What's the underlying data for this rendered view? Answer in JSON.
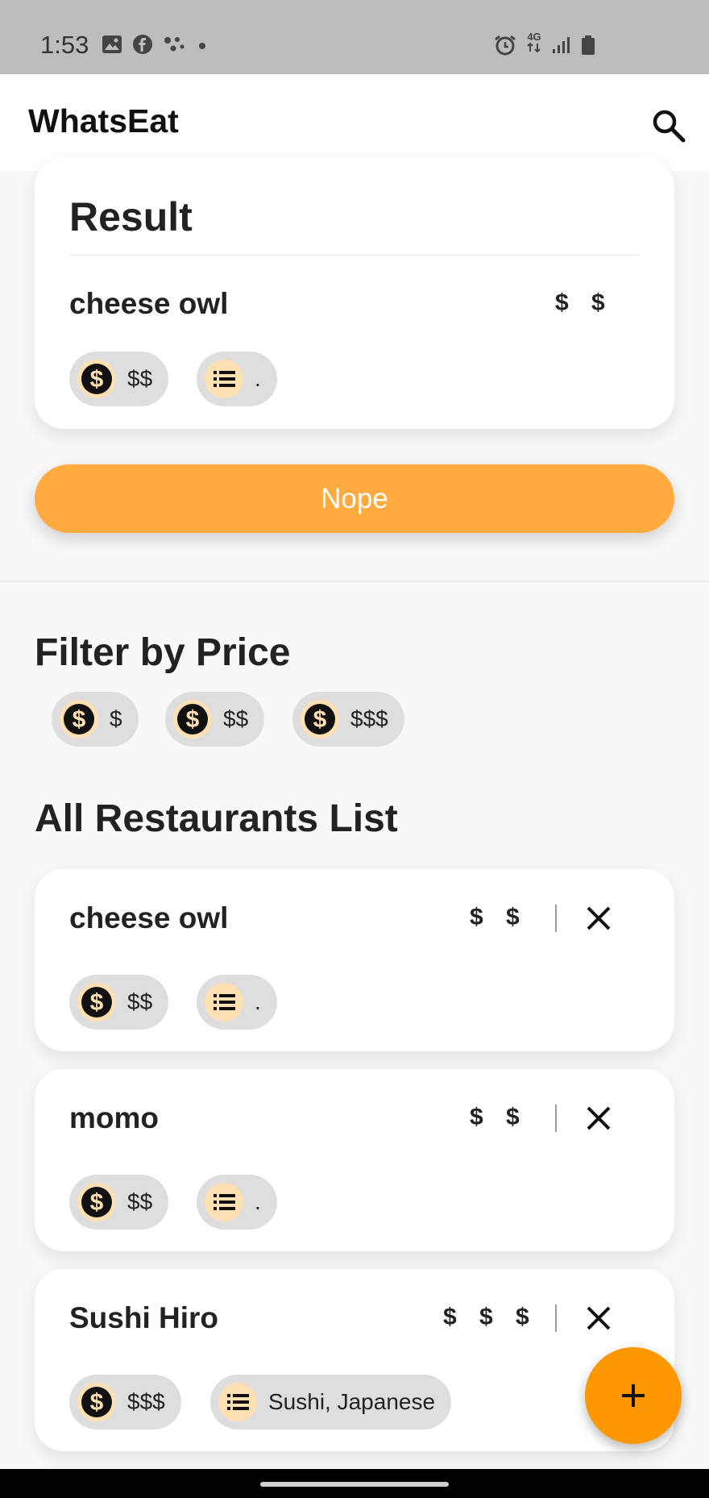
{
  "status_bar": {
    "time": "1:53",
    "network_label": "4G",
    "left_icons": [
      "gallery-icon",
      "facebook-icon",
      "dots-app-icon",
      "dot-icon"
    ],
    "right_icons": [
      "alarm-icon",
      "network-4g-icon",
      "signal-icon",
      "battery-icon"
    ]
  },
  "app_bar": {
    "title": "WhatsEat",
    "search_icon": "search-icon"
  },
  "result": {
    "title": "Result",
    "name": "cheese owl",
    "price_display": "$ $",
    "chips": [
      {
        "icon": "dollar-icon",
        "label": "$$"
      },
      {
        "icon": "list-icon",
        "label": "."
      }
    ]
  },
  "nope_button": {
    "label": "Nope"
  },
  "filter": {
    "title": "Filter by Price",
    "chips": [
      {
        "icon": "dollar-icon",
        "label": "$"
      },
      {
        "icon": "dollar-icon",
        "label": "$$"
      },
      {
        "icon": "dollar-icon",
        "label": "$$$"
      }
    ]
  },
  "list": {
    "title": "All Restaurants List",
    "items": [
      {
        "name": "cheese owl",
        "price_display": "$ $",
        "price_chip": "$$",
        "category_chip": "."
      },
      {
        "name": "momo",
        "price_display": "$ $",
        "price_chip": "$$",
        "category_chip": "."
      },
      {
        "name": "Sushi Hiro",
        "price_display": "$ $ $",
        "price_chip": "$$$",
        "category_chip": "Sushi, Japanese"
      }
    ]
  },
  "fab": {
    "icon": "plus-icon"
  },
  "colors": {
    "accent": "#FF9800",
    "button": "#FFAB40",
    "chip_bg": "#DEDEDE",
    "chip_icon_bg": "#FFE0B2",
    "status_bar": "#BDBDBD"
  }
}
